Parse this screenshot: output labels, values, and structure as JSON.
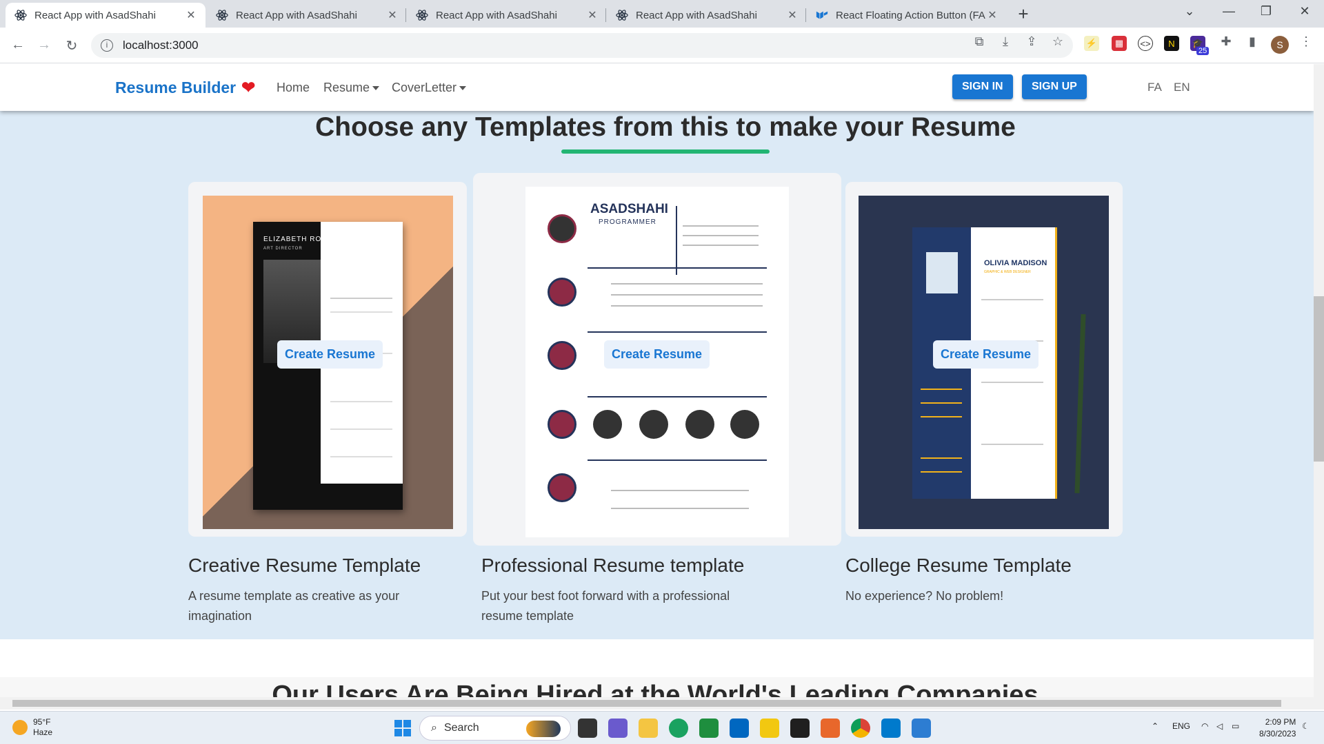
{
  "browser": {
    "tabs": [
      {
        "title": "React App with AsadShahi",
        "active": true
      },
      {
        "title": "React App with AsadShahi",
        "active": false
      },
      {
        "title": "React App with AsadShahi",
        "active": false
      },
      {
        "title": "React App with AsadShahi",
        "active": false
      },
      {
        "title": "React Floating Action Button (FA",
        "active": false
      }
    ],
    "url": "localhost:3000",
    "profile_initial": "S",
    "extension_badge": "25"
  },
  "navbar": {
    "brand": "Resume Builder",
    "links": {
      "home": "Home",
      "resume": "Resume",
      "coverletter": "CoverLetter"
    },
    "sign_in": "SIGN IN",
    "sign_up": "SIGN UP",
    "lang_fa": "FA",
    "lang_en": "EN"
  },
  "main": {
    "heading": "Choose any Templates from this to make your Resume",
    "create_label": "Create Resume",
    "templates": [
      {
        "title": "Creative Resume Template",
        "desc": "A resume template as creative as your imagination",
        "preview_name": "ELIZABETH RODRERG",
        "preview_role": "ART DIRECTOR"
      },
      {
        "title": "Professional Resume template",
        "desc": "Put your best foot forward with a professional resume template",
        "preview_name": "ASADSHAHI",
        "preview_role": "PROGRAMMER"
      },
      {
        "title": "College Resume Template",
        "desc": "No experience? No problem!",
        "preview_name": "OLIVIA MADISON",
        "preview_role": "GRAPHIC & WEB DESIGNER"
      }
    ],
    "heading2": "Our Users Are Being Hired at the World's Leading Companies"
  },
  "taskbar": {
    "temp": "95°F",
    "weather": "Haze",
    "search": "Search",
    "lang": "ENG",
    "time": "2:09 PM",
    "date": "8/30/2023"
  },
  "colors": {
    "brand": "#1a73c8",
    "accent": "#22b573",
    "button": "#1976d2",
    "page_bg": "#dceaf6"
  }
}
